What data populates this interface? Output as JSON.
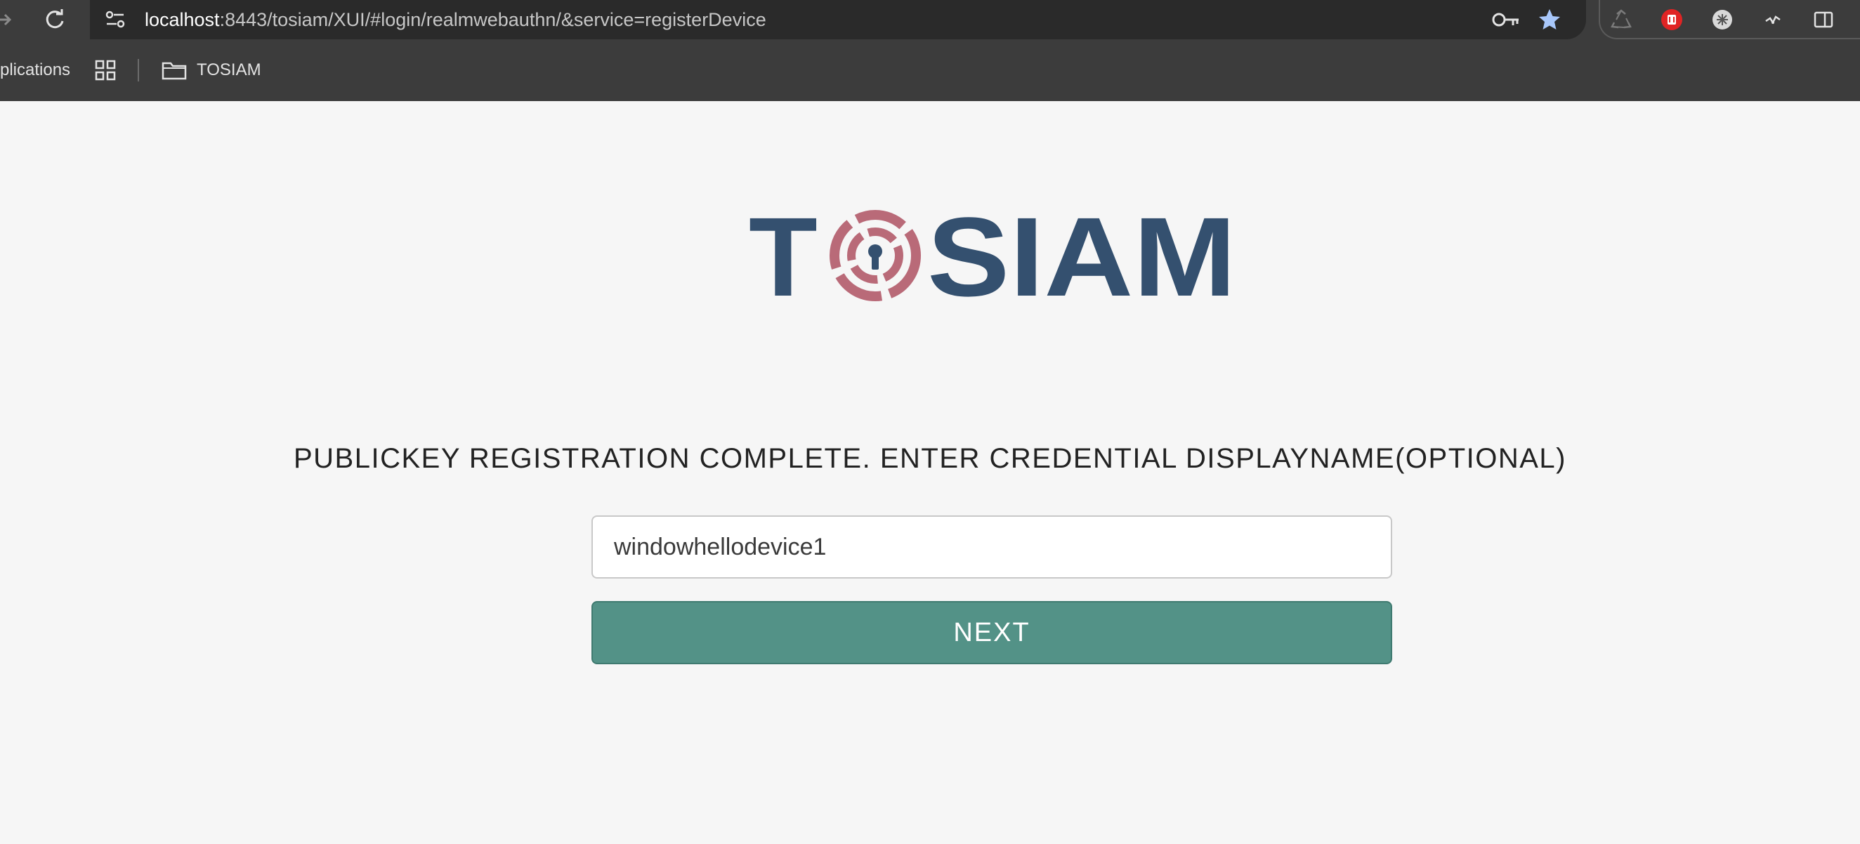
{
  "browser": {
    "url_host": "localhost",
    "url_rest": ":8443/tosiam/XUI/#login/realmwebauthn/&service=registerDevice",
    "icons": [
      "forward-icon",
      "reload-icon",
      "site-info-icon",
      "password-key-icon",
      "bookmark-star-icon",
      "recycle-extension-icon",
      "red-extension-icon",
      "white-extension-icon",
      "dark-extension-icon",
      "side-panel-icon"
    ]
  },
  "bookmarks": {
    "apps_label": "plications",
    "folder_label": "TOSIAM"
  },
  "logo": {
    "text_left": "T",
    "text_right": "SIAM",
    "brand_color": "#34506f",
    "ring_color": "#b96a78"
  },
  "form": {
    "heading": "PUBLICKEY REGISTRATION COMPLETE. ENTER CREDENTIAL DISPLAYNAME(OPTIONAL)",
    "input_value": "windowhellodevice1",
    "next_label": "NEXT",
    "button_color": "#539287"
  }
}
